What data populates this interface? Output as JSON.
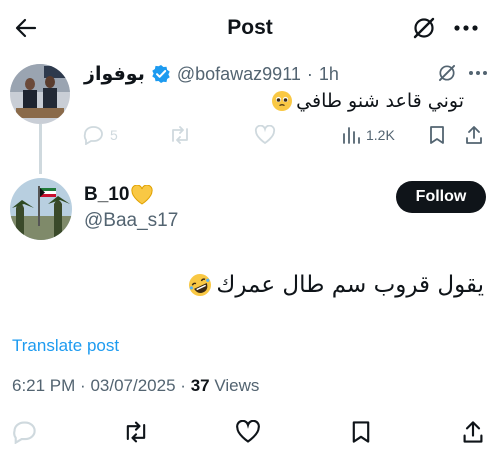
{
  "header": {
    "title": "Post"
  },
  "parent": {
    "display_name": "بوفواز",
    "handle": "@bofawaz9911",
    "separator": "·",
    "time": "1h",
    "text": "توني قاعد شنو طافي",
    "views": "1.2K",
    "replies": "5"
  },
  "reply": {
    "display_name": "B_10",
    "handle": "@Baa_s17",
    "follow_label": "Follow",
    "text": "يقول قروب سم طال عمرك",
    "translate_label": "Translate post",
    "time": "6:21 PM",
    "date": "03/07/2025",
    "separator": "·",
    "views_count": "37",
    "views_label": "Views"
  },
  "colors": {
    "verified": "#1d9bf0",
    "link": "#1d9bf0",
    "follow_bg": "#0f1419",
    "muted": "#536471",
    "heart_emoji": "#f9c844"
  }
}
